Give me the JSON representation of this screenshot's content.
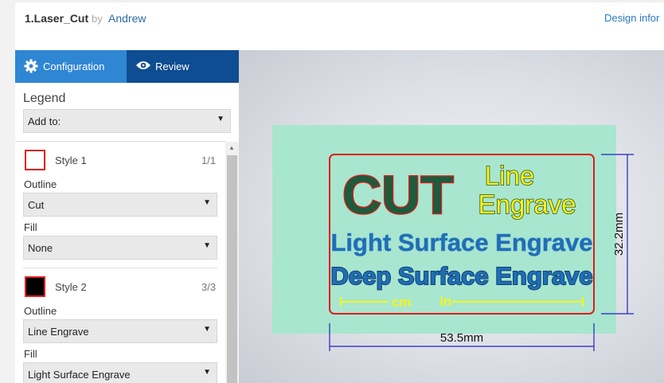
{
  "header": {
    "title": "1.Laser_Cut",
    "by": "by",
    "author": "Andrew",
    "design_info": "Design infor"
  },
  "tabs": {
    "configuration": "Configuration",
    "review": "Review"
  },
  "legend": {
    "title": "Legend",
    "add_to": "Add to:"
  },
  "styles": [
    {
      "name": "Style 1",
      "count": "1/1",
      "swatch_fill": "#ffffff",
      "outline_label": "Outline",
      "outline": "Cut",
      "fill_label": "Fill",
      "fill": "None"
    },
    {
      "name": "Style 2",
      "count": "3/3",
      "swatch_fill": "#000000",
      "outline_label": "Outline",
      "outline": "Line Engrave",
      "fill_label": "Fill",
      "fill": "Light Surface Engrave"
    }
  ],
  "design": {
    "cut_text": "CUT",
    "line_text_1": "Line",
    "line_text_2": "Engrave",
    "light_text": "Light Surface Engrave",
    "deep_text": "Deep Surface Engrave",
    "ruler_cm": "cm",
    "ruler_in": "in",
    "width_label": "53.5mm",
    "height_label": "32.2mm"
  },
  "colors": {
    "tab_active": "#2f86d3",
    "tab_bar": "#0e4d92",
    "material": "#a8e6cf",
    "cut_red": "#e01b1b",
    "engrave_yellow": "#f5f51a",
    "surface_blue": "#1f6fb4",
    "dimension_blue": "#2020c8"
  }
}
